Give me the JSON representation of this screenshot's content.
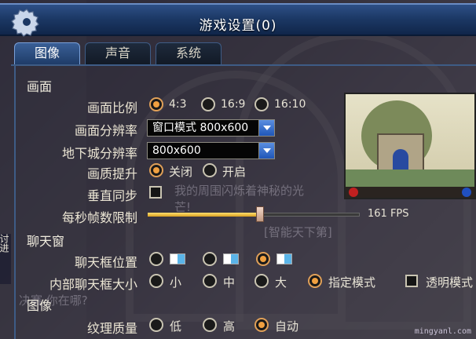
{
  "window": {
    "title": "游戏设置(0)",
    "tabs": [
      {
        "label": "图像",
        "active": true
      },
      {
        "label": "声音",
        "active": false
      },
      {
        "label": "系统",
        "active": false
      }
    ]
  },
  "graphics": {
    "section_title": "画面",
    "aspect_ratio": {
      "label": "画面比例",
      "options": [
        "4:3",
        "16:9",
        "16:10"
      ],
      "selected": "4:3"
    },
    "resolution": {
      "label": "画面分辨率",
      "value": "窗口模式 800x600"
    },
    "dungeon_resolution": {
      "label": "地下城分辨率",
      "value": "800x600"
    },
    "quality_boost": {
      "label": "画质提升",
      "options": [
        "关闭",
        "开启"
      ],
      "selected": "关闭"
    },
    "vsync": {
      "label": "垂直同步",
      "checked": false
    },
    "fps_limit": {
      "label": "每秒帧数限制",
      "value_text": "161 FPS",
      "fraction": 0.53
    }
  },
  "chat": {
    "section_title": "聊天窗",
    "position": {
      "label": "聊天框位置",
      "options": [
        "left",
        "middle",
        "right"
      ],
      "selected_index": 2
    },
    "inner_size": {
      "label": "内部聊天框大小",
      "options": [
        "小",
        "中",
        "大",
        "指定模式"
      ],
      "selected": "指定模式",
      "transparent_label": "透明模式",
      "transparent_checked": false
    }
  },
  "image2": {
    "section_title": "图像",
    "texture": {
      "label": "纹理质量",
      "options": [
        "低",
        "高",
        "自动"
      ],
      "selected": "自动"
    }
  },
  "background_text": {
    "ghost1": "我的周围闪烁着神秘的光芒!",
    "ghost2": "[智能天下第]",
    "ghost3": "决赛 你在哪?",
    "side": "讨进"
  },
  "watermark": "mingyanl.com",
  "colors": {
    "accent": "#f0a040",
    "title_bar": "#1b3763",
    "tab_active": "#3a5f96"
  }
}
